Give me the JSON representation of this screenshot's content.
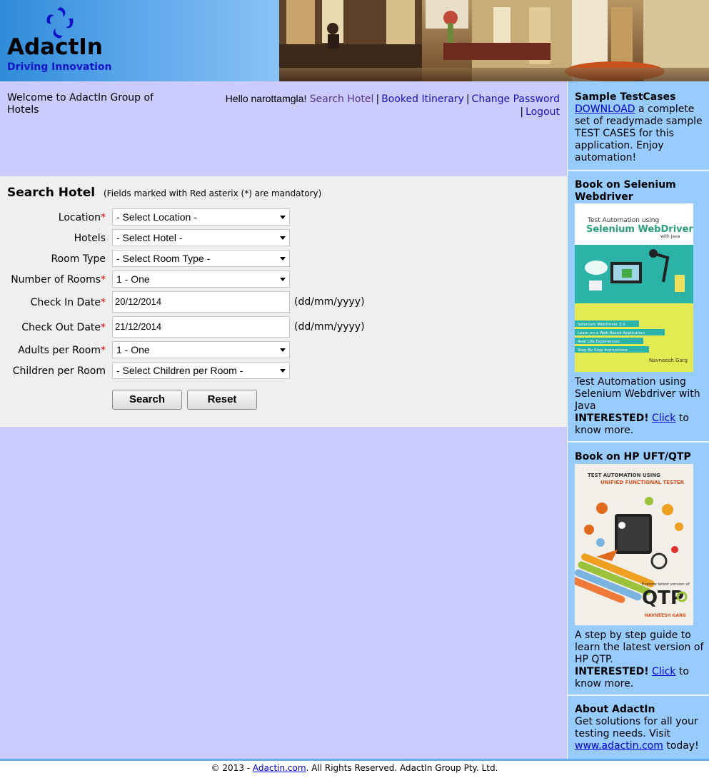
{
  "brand": {
    "name": "AdactIn",
    "tagline": "Driving Innovation"
  },
  "welcome_text": "Welcome to AdactIn Group of Hotels",
  "topnav": {
    "greeting": "Hello narottamgla!",
    "search_hotel": "Search Hotel",
    "booked_itinerary": "Booked Itinerary",
    "change_password": "Change Password",
    "logout": "Logout",
    "separator": "|"
  },
  "form": {
    "title": "Search Hotel",
    "note": "(Fields marked with Red asterix (*) are mandatory)",
    "required_mark": "*",
    "fields": {
      "location": {
        "label": "Location",
        "value": "- Select Location -"
      },
      "hotels": {
        "label": "Hotels",
        "value": "- Select Hotel -"
      },
      "room_type": {
        "label": "Room Type",
        "value": "- Select Room Type -"
      },
      "num_rooms": {
        "label": "Number of Rooms",
        "value": "1 - One"
      },
      "check_in": {
        "label": "Check In Date",
        "value": "20/12/2014",
        "hint": "(dd/mm/yyyy)"
      },
      "check_out": {
        "label": "Check Out Date",
        "value": "21/12/2014",
        "hint": "(dd/mm/yyyy)"
      },
      "adults": {
        "label": "Adults per Room",
        "value": "1 - One"
      },
      "children": {
        "label": "Children per Room",
        "value": "- Select Children per Room -"
      }
    },
    "search_button": "Search",
    "reset_button": "Reset"
  },
  "sidebar": {
    "testcases": {
      "title": "Sample TestCases",
      "link": "DOWNLOAD",
      "text": " a complete set of readymade sample TEST CASES for this application. Enjoy automation!"
    },
    "selenium_book": {
      "title": "Book on Selenium Webdriver",
      "cover_line1": "Test Automation using",
      "cover_line2": "Selenium WebDriver",
      "cover_line3": "with Java",
      "cover_bullets": [
        "Selenium WebDriver 2.0",
        "Learn on a Web Based Application",
        "Real Life Experiences",
        "Step By Step Instructions"
      ],
      "cover_author": "Navneesh Garg",
      "description": "Test Automation using Selenium Webdriver with Java",
      "interested": "INTERESTED!",
      "click": "Click",
      "more": " to know more."
    },
    "qtp_book": {
      "title": "Book on HP UFT/QTP",
      "cover_line1": "TEST AUTOMATION USING",
      "cover_line2": "UNIFIED FUNCTIONAL TESTER",
      "cover_tagline": "Explore latest version of",
      "cover_big": "QTP",
      "cover_author": "NAVNEESH GARG",
      "description": "A step by step guide to learn the latest version of HP QTP.",
      "interested": "INTERESTED!",
      "click": "Click",
      "more": " to know more."
    },
    "about": {
      "title": "About AdactIn",
      "text": "Get solutions for all your testing needs. Visit ",
      "link": "www.adactin.com",
      "after": " today!"
    }
  },
  "footer": {
    "prefix": "© 2013 - ",
    "link": "Adactin.com",
    "suffix": ". All Rights Reserved. AdactIn Group Pty. Ltd."
  },
  "colors": {
    "main_bg": "#cccbfd",
    "sidebar_bg": "#99ccfe",
    "panel_bg": "#efefef",
    "link": "#1414b8",
    "required": "#e00000"
  }
}
